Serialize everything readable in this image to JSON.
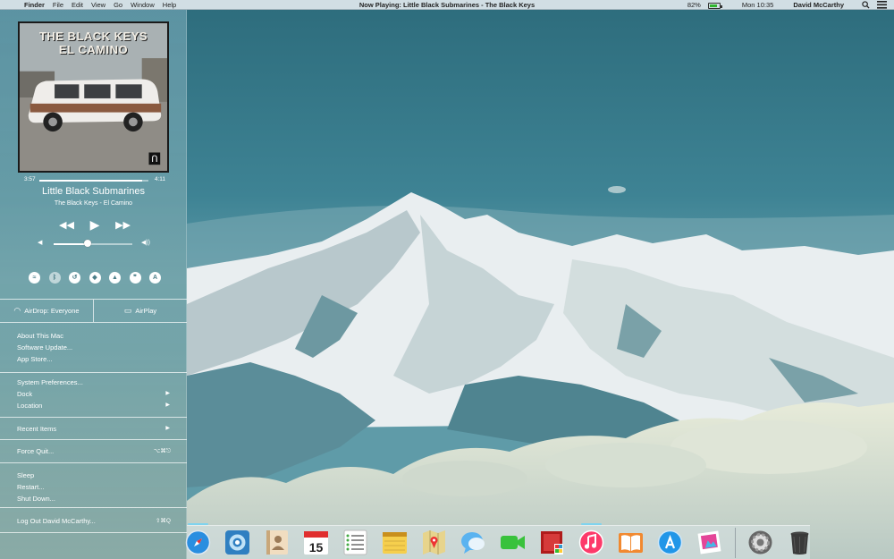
{
  "menubar": {
    "apple_icon": "apple-icon",
    "app_name": "Finder",
    "menus": [
      "File",
      "Edit",
      "View",
      "Go",
      "Window",
      "Help"
    ],
    "now_playing": "Now Playing: Little Black Submarines - The Black Keys",
    "battery_percent": "82%",
    "battery_level": 0.82,
    "clock": "Mon 10:35",
    "user": "David McCarthy",
    "search_icon": "search-icon",
    "notifications_icon": "notification-center-icon"
  },
  "player": {
    "album_art_line1": "THE BLACK KEYS",
    "album_art_line2": "EL CAMINO",
    "elapsed": "3:57",
    "duration": "4:11",
    "progress": 0.94,
    "title": "Little Black Submarines",
    "subtitle": "The Black Keys - El Camino",
    "volume_level": 0.43
  },
  "toggles": [
    {
      "name": "wifi-toggle",
      "icon": "wifi-icon",
      "glyph": "≈",
      "active": true
    },
    {
      "name": "bluetooth-toggle",
      "icon": "bluetooth-icon",
      "glyph": "ᛒ",
      "active": false
    },
    {
      "name": "time-machine-toggle",
      "icon": "time-machine-icon",
      "glyph": "↺",
      "active": true
    },
    {
      "name": "dropbox-toggle",
      "icon": "dropbox-icon",
      "glyph": "◆",
      "active": true
    },
    {
      "name": "google-drive-toggle",
      "icon": "drive-icon",
      "glyph": "▲",
      "active": true
    },
    {
      "name": "quotes-toggle",
      "icon": "quote-icon",
      "glyph": "❞",
      "active": true
    },
    {
      "name": "alfred-toggle",
      "icon": "alfred-icon",
      "glyph": "A",
      "active": true
    }
  ],
  "airdrop": {
    "label": "AirDrop: Everyone"
  },
  "airplay": {
    "label": "AirPlay"
  },
  "menu": {
    "about": "About This Mac",
    "software_update": "Software Update...",
    "app_store": "App Store...",
    "system_preferences": "System Preferences...",
    "dock": "Dock",
    "location": "Location",
    "recent_items": "Recent Items",
    "force_quit": "Force Quit...",
    "force_quit_shortcut": "⌥⌘⎋",
    "sleep": "Sleep",
    "restart": "Restart...",
    "shut_down": "Shut Down...",
    "log_out": "Log Out David McCarthy...",
    "log_out_shortcut": "⇧⌘Q"
  },
  "dock": {
    "calendar_date": "15",
    "apps": [
      "safari-icon",
      "iphoto-icon",
      "contacts-icon",
      "calendar-icon",
      "reminders-icon",
      "notes-icon",
      "maps-icon",
      "messages-icon",
      "facetime-icon",
      "photo-booth-icon",
      "itunes-icon",
      "ibooks-icon",
      "app-store-icon",
      "preview-icon",
      "system-preferences-icon",
      "trash-icon"
    ],
    "running": [
      "safari-icon",
      "itunes-icon"
    ]
  },
  "colors": {
    "panel": "#78aab9",
    "accent": "#7fd3ee",
    "sky": "#3d7f90"
  }
}
